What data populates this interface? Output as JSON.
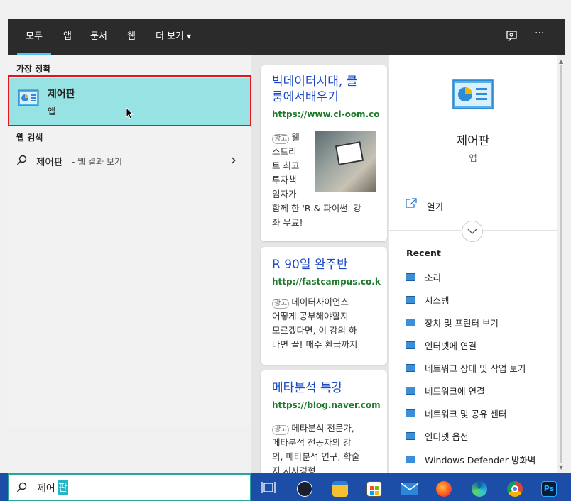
{
  "top_bar": {
    "tabs": [
      "모두",
      "앱",
      "문서",
      "웹",
      "더 보기"
    ],
    "more_glyph": "▾",
    "dots": "···"
  },
  "left": {
    "best_match_header": "가장 정확",
    "best_match_title": "제어판",
    "best_match_type": "앱",
    "web_search_header": "웹 검색",
    "web_query": "제어판",
    "web_suffix": "- 웹 결과 보기",
    "chevron": "›"
  },
  "ads": [
    {
      "title": "빅데이터시대, 클룸에서배우기",
      "title_l1": "빅데이터시대, 클",
      "title_l2": "룸에서배우기",
      "url": "https://www.cl-oom.co",
      "badge": "광고",
      "body_lines": [
        "웰",
        "스트리",
        "트 최고",
        "투자책",
        "임자가",
        "함께 한 'R & 파이썬' 강",
        "좌 무료!"
      ]
    },
    {
      "title": "R 90일 완주반",
      "url": "http://fastcampus.co.k",
      "badge": "광고",
      "body_lines": [
        "데이터사이언스",
        "어떻게 공부해야할지",
        "모르겠다면, 이 강의 하",
        "나면 끝! 매주 환급까지"
      ]
    },
    {
      "title": "메타분석 특강",
      "url": "https://blog.naver.com",
      "badge": "광고",
      "body_lines": [
        "메타분석 전문가,",
        "메타분석 전공자의 강",
        "의, 메타분석 연구, 학술",
        "지 시사경형"
      ]
    }
  ],
  "right": {
    "app_name": "제어판",
    "app_type": "앱",
    "open_label": "열기",
    "recent_header": "Recent",
    "recent_items": [
      "소리",
      "시스템",
      "장치 및 프린터 보기",
      "인터넷에 연결",
      "네트워크 상태 및 작업 보기",
      "네트워크에 연결",
      "네트워크 및 공유 센터",
      "인터넷 옵션",
      "Windows Defender 방화벽"
    ]
  },
  "search": {
    "typed": "제어",
    "highlighted": "판"
  },
  "colors": {
    "accent": "#4cc2ff",
    "selection": "#97e2e2",
    "highlight_border": "#e8121f",
    "taskbar": "#1c4ea8"
  }
}
